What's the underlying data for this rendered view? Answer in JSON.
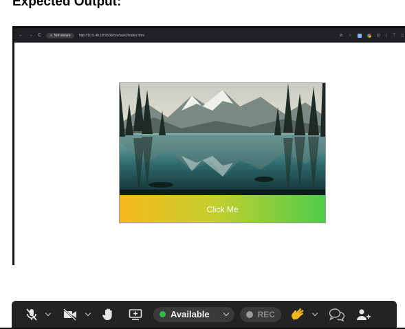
{
  "heading": "Expected Output:",
  "browser": {
    "nav_back": "←",
    "nav_forward": "→",
    "nav_reload": "C",
    "security_label": "Not secure",
    "url": "http://10.5.48.18:5500/css/task2/index.html"
  },
  "page": {
    "button_label": "Click Me",
    "button_gradient": [
      "#f6b91c",
      "#4fcc4a"
    ]
  },
  "toolbar": {
    "status_label": "Available",
    "status_color": "#2dbe4a",
    "rec_label": "REC",
    "icons": [
      "microphone-muted-icon",
      "video-off-icon",
      "raise-hand-icon",
      "share-screen-icon",
      "clap-emoji-icon",
      "chat-icon",
      "add-person-icon"
    ]
  }
}
